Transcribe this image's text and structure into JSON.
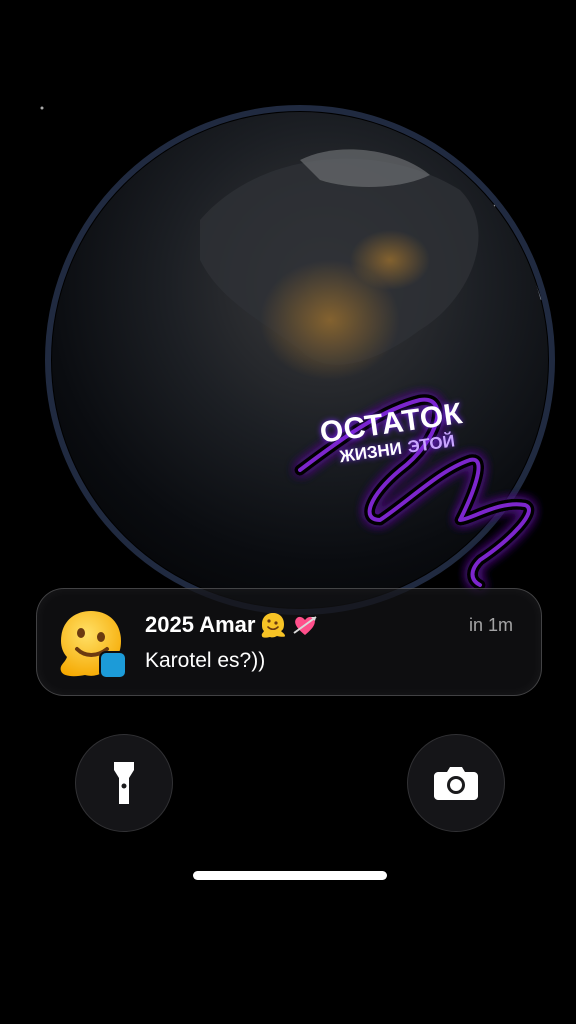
{
  "wallpaper": {
    "sticker_line1": "ОСТАТОК",
    "sticker_line2_a": "ЖИЗНИ",
    "sticker_line2_b": "ЭТОЙ",
    "accent_color": "#8a2be2"
  },
  "notification": {
    "title": "2025 Amar",
    "time": "in 1m",
    "body": "Karotel es?))",
    "app_icon": "melting-face-emoji",
    "title_emojis": [
      "melting-face-emoji",
      "heart-with-arrow-emoji"
    ],
    "badge_icon": "messenger-app-icon"
  },
  "controls": {
    "flashlight_icon": "flashlight-icon",
    "camera_icon": "camera-icon"
  }
}
